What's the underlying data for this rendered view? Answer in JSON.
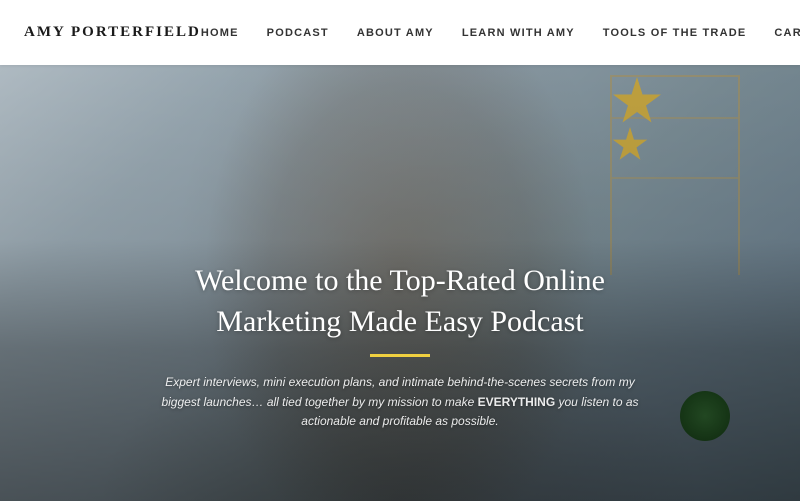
{
  "header": {
    "logo": "AMY PORTERFIELD",
    "nav": {
      "items": [
        {
          "label": "HOME",
          "id": "nav-home"
        },
        {
          "label": "PODCAST",
          "id": "nav-podcast"
        },
        {
          "label": "ABOUT AMY",
          "id": "nav-about"
        },
        {
          "label": "LEARN WITH AMY",
          "id": "nav-learn"
        },
        {
          "label": "TOOLS OF THE TRADE",
          "id": "nav-tools"
        },
        {
          "label": "CAREERS",
          "id": "nav-careers"
        }
      ]
    }
  },
  "hero": {
    "title": "Welcome to the Top-Rated Online Marketing Made Easy Podcast",
    "subtitle": "Expert interviews, mini execution plans, and intimate behind-the-scenes secrets from my biggest launches… all tied together by my mission to make EVERYTHING you listen to as actionable and profitable as possible.",
    "subtitle_bold": "EVERYTHING"
  }
}
